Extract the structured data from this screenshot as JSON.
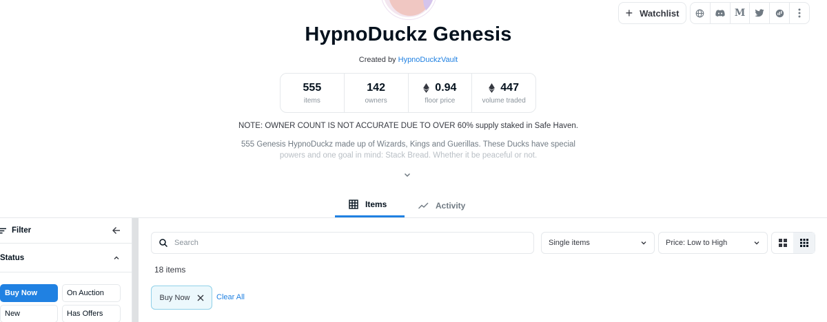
{
  "header": {
    "watchlist_label": "Watchlist",
    "social_icons": [
      "globe-icon",
      "discord-icon",
      "medium-icon",
      "twitter-icon",
      "explorer-icon",
      "more-icon"
    ]
  },
  "collection": {
    "title": "HypnoDuckz Genesis",
    "created_prefix": "Created by",
    "creator": "HypnoDuckzVault",
    "stats": [
      {
        "value": "555",
        "label": "items",
        "eth": false
      },
      {
        "value": "142",
        "label": "owners",
        "eth": false
      },
      {
        "value": "0.94",
        "label": "floor price",
        "eth": true
      },
      {
        "value": "447",
        "label": "volume traded",
        "eth": true
      }
    ],
    "note": "NOTE: OWNER COUNT IS NOT ACCURATE DUE TO OVER 60% supply staked in Safe Haven.",
    "description_line1": "555 Genesis HypnoDuckz made up of Wizards, Kings and Guerillas. These Ducks have special",
    "description_line2": "powers and one goal in mind: Stack Bread. Whether it be peaceful or not."
  },
  "tabs": [
    {
      "label": "Items",
      "icon": "grid-icon",
      "active": true
    },
    {
      "label": "Activity",
      "icon": "activity-icon",
      "active": false
    }
  ],
  "sidebar": {
    "filter_label": "Filter",
    "status_label": "Status",
    "status_options": [
      {
        "label": "Buy Now",
        "selected": true
      },
      {
        "label": "On Auction",
        "selected": false
      },
      {
        "label": "New",
        "selected": false
      },
      {
        "label": "Has Offers",
        "selected": false
      }
    ]
  },
  "main": {
    "search_placeholder": "Search",
    "items_select": "Single items",
    "sort_select": "Price: Low to High",
    "item_count": "18 items",
    "active_filter": "Buy Now",
    "clear_all": "Clear All"
  },
  "colors": {
    "accent": "#2081e2",
    "text": "#04111d",
    "muted": "#707a83",
    "border": "#e5e8eb"
  }
}
